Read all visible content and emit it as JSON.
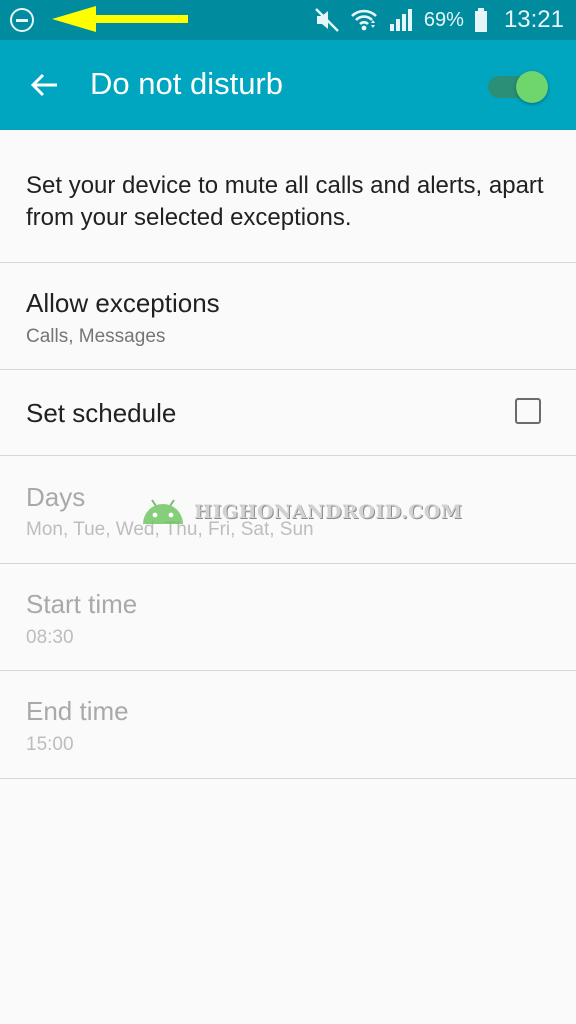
{
  "status_bar": {
    "battery_percent": "69%",
    "time": "13:21",
    "icons": [
      "do-not-disturb-icon",
      "arrow-left-annotation",
      "mute-icon",
      "wifi-icon",
      "signal-icon",
      "battery-icon"
    ],
    "annotation_color": "#ffff00"
  },
  "app_bar": {
    "title": "Do not disturb",
    "back_icon": "arrow-back-icon",
    "toggle_on": true,
    "color": "#00a5c0"
  },
  "description": "Set your device to mute all calls and alerts, apart from your selected exceptions.",
  "settings": {
    "allow_exceptions": {
      "title": "Allow exceptions",
      "summary": "Calls, Messages"
    },
    "set_schedule": {
      "title": "Set schedule",
      "checked": false
    },
    "days": {
      "title": "Days",
      "summary": "Mon, Tue, Wed, Thu, Fri, Sat, Sun"
    },
    "start_time": {
      "title": "Start time",
      "summary": "08:30"
    },
    "end_time": {
      "title": "End time",
      "summary": "15:00"
    }
  },
  "watermark": {
    "text": "HIGHONANDROID.COM",
    "icon": "android-logo"
  }
}
